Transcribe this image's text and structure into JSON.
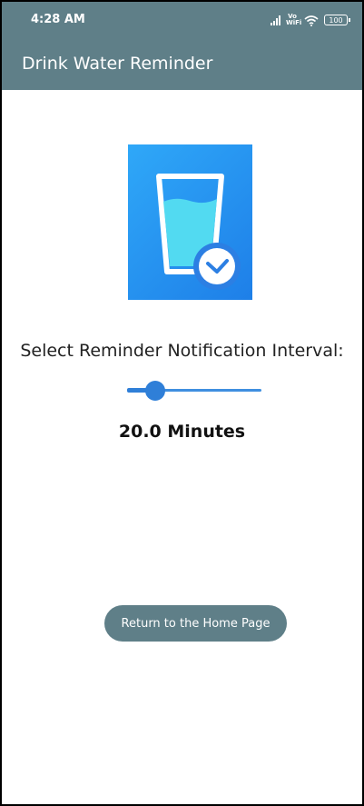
{
  "status_bar": {
    "time": "4:28 AM",
    "network_label": "Vo WiFi",
    "battery": "100"
  },
  "app_bar": {
    "title": "Drink Water Reminder"
  },
  "main": {
    "app_icon": "water-glass-clock-icon",
    "interval_label": "Select Reminder Notification Interval:",
    "slider_fraction": 0.15,
    "value_text": "20.0 Minutes",
    "home_button_label": "Return to the Home Page"
  },
  "colors": {
    "toolbar": "#5f7f88",
    "accent": "#2f7fd8",
    "icon_background": "#2196f3",
    "water": "#4fd8f0"
  }
}
